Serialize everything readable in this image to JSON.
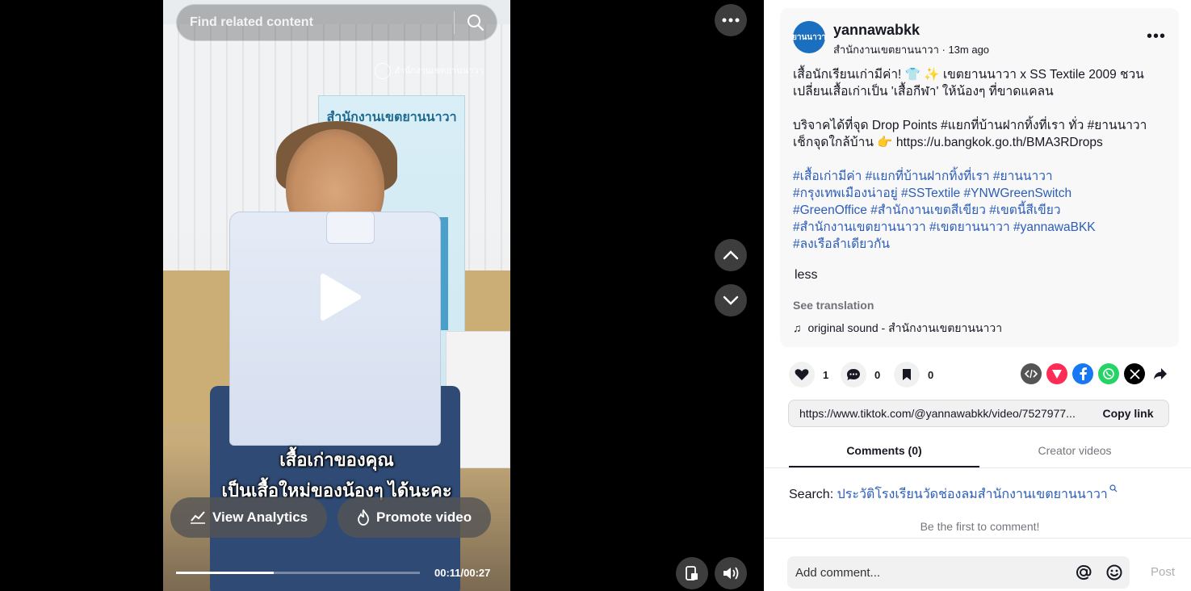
{
  "video": {
    "search_placeholder": "Find related content",
    "watermark": "สำนักงานเขตยานนาวา",
    "banner_title": "สำนักงานเขตยานนาวา",
    "caption_line1": "เสื้อเก่าของคุณ",
    "caption_line2": "เป็นเสื้อใหม่ของน้องๆ ได้นะคะ",
    "analytics_label": "View Analytics",
    "promote_label": "Promote video",
    "time": "00:11/00:27",
    "progress": 0.4
  },
  "post": {
    "avatar_text": "ยานนาวา",
    "username": "yannawabkk",
    "subline": "สำนักงานเขตยานนาวา · 13m ago",
    "more": "•••",
    "desc_line1": "เสื้อนักเรียนเก่ามีค่า! 👕 ✨ เขตยานนาวา x SS Textile 2009 ชวน",
    "desc_line2": "เปลี่ยนเสื้อเก่าเป็น 'เสื้อกีฬา' ให้น้องๆ ที่ขาดแคลน",
    "desc_line3": "บริจาคได้ที่จุด Drop Points #แยกที่บ้านฝากทิ้งที่เรา ทั่ว #ยานนาวา",
    "desc_line4": "เช็กจุดใกล้บ้าน 👉 https://u.bangkok.go.th/BMA3RDrops",
    "tags1": "#เสื้อเก่ามีค่า #แยกที่บ้านฝากทิ้งที่เรา #ยานนาวา",
    "tags2": "#กรุงเทพเมืองน่าอยู่ #SSTextile #YNWGreenSwitch",
    "tags3": "#GreenOffice #สำนักงานเขตสีเขียว #เขตนี้สีเขียว",
    "tags4": "#สำนักงานเขตยานนาวา #เขตยานนาวา #yannawaBKK",
    "tags5": "#ลงเรือลำเดียวกัน",
    "less": "less",
    "see_translation": "See translation",
    "sound": "original sound - สำนักงานเขตยานนาวา"
  },
  "actions": {
    "likes": "1",
    "comments": "0",
    "saves": "0"
  },
  "link": {
    "url": "https://www.tiktok.com/@yannawabkk/video/7527977...",
    "copy": "Copy link"
  },
  "tabs": {
    "comments": "Comments (0)",
    "creator": "Creator videos"
  },
  "search_sugg": {
    "prefix": "Search: ",
    "keyword": "ประวัติโรงเรียนวัดช่องลมสำนักงานเขตยานนาวา"
  },
  "first_comment": "Be the first to comment!",
  "comment": {
    "placeholder": "Add comment...",
    "post": "Post"
  },
  "colors": {
    "accent": "#fe2c55",
    "link": "#2b5db9",
    "facebook": "#1877f2",
    "whatsapp": "#25d366"
  }
}
